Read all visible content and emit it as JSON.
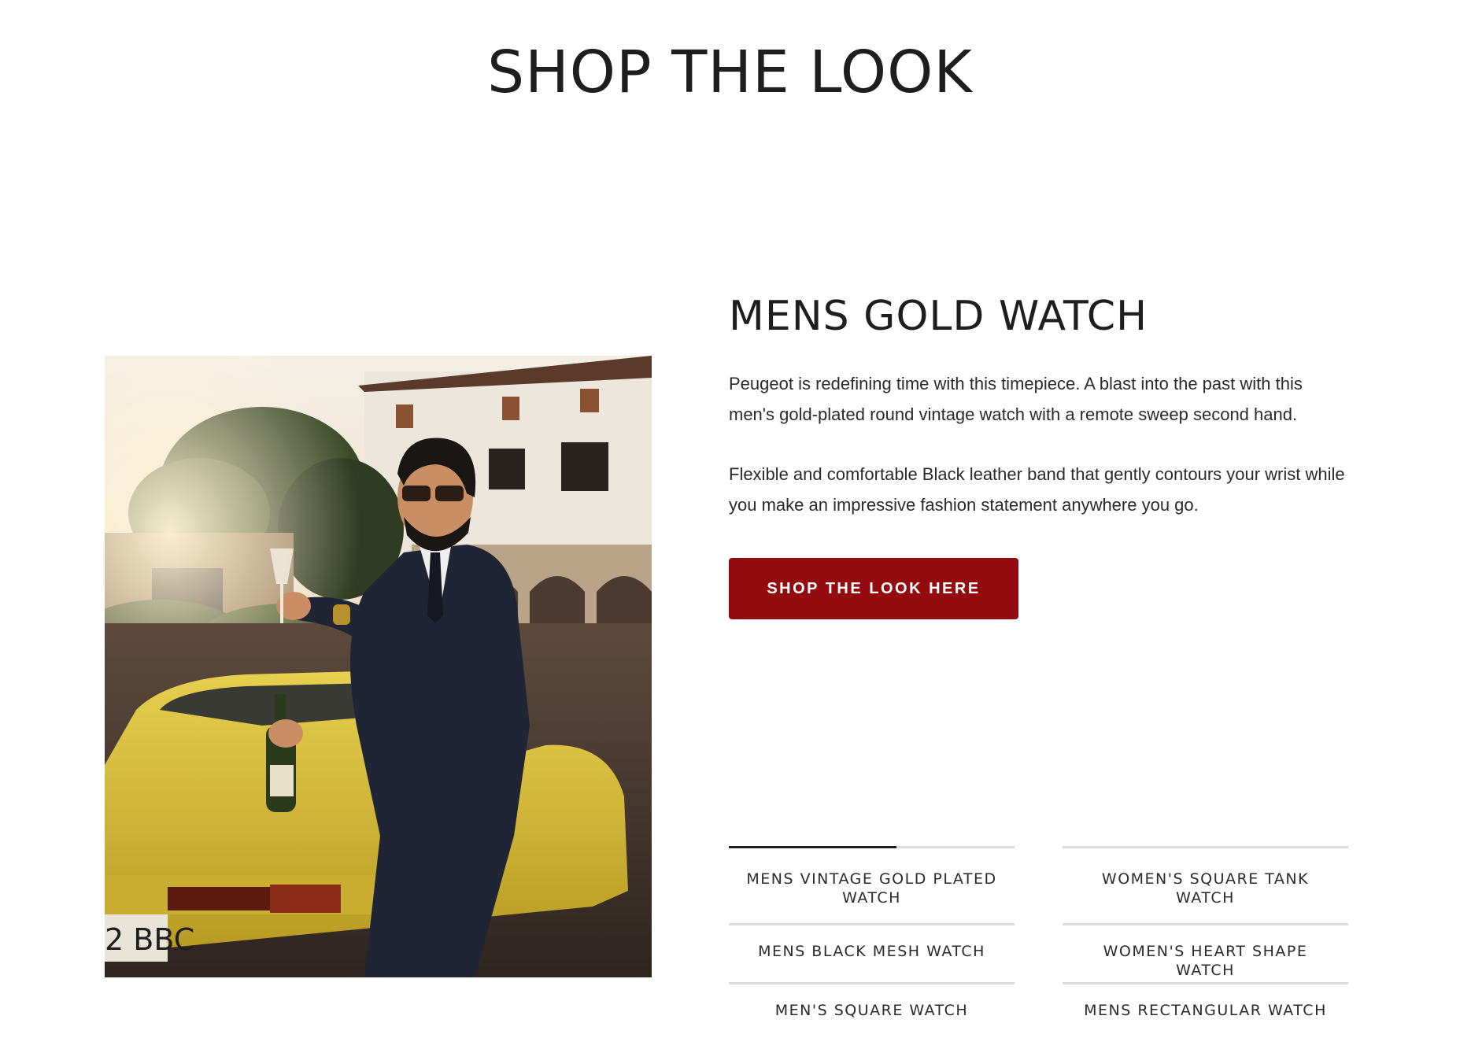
{
  "section": {
    "title": "SHOP THE LOOK"
  },
  "product": {
    "title": "MENS GOLD WATCH",
    "description_1": "Peugeot is redefining time with this timepiece. A blast into the past with this men's gold-plated round vintage watch with a remote sweep second hand.",
    "description_2": "Flexible and comfortable Black leather band that gently contours your wrist while you make an impressive fashion statement anywhere you go.",
    "cta_label": "SHOP THE LOOK HERE",
    "cta_color": "#930b0e"
  },
  "photo": {
    "license_plate": "2 BBC"
  },
  "tabs": [
    {
      "label": "MENS VINTAGE GOLD PLATED WATCH",
      "active": true
    },
    {
      "label": "WOMEN'S SQUARE TANK WATCH",
      "active": false
    },
    {
      "label": "MENS BLACK MESH WATCH",
      "active": false
    },
    {
      "label": "WOMEN'S HEART SHAPE WATCH",
      "active": false
    },
    {
      "label": "MEN'S SQUARE WATCH",
      "active": false
    },
    {
      "label": "MENS RECTANGULAR WATCH",
      "active": false
    }
  ]
}
